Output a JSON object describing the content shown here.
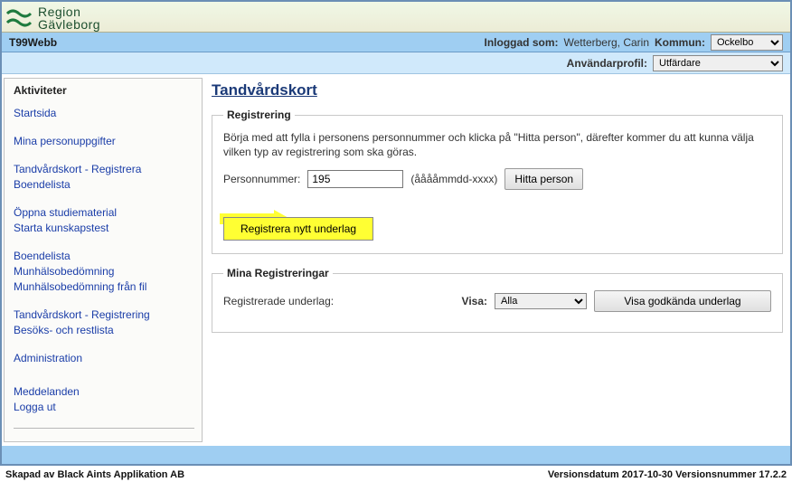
{
  "brand": {
    "line1": "Region",
    "line2": "Gävleborg"
  },
  "topbar": {
    "appname": "T99Webb",
    "logged_in_label": "Inloggad som:",
    "logged_in_user": "Wetterberg, Carin",
    "kommun_label": "Kommun:",
    "kommun_value": "Ockelbo"
  },
  "subbar": {
    "profile_label": "Användarprofil:",
    "profile_value": "Utfärdare"
  },
  "sidebar": {
    "title": "Aktiviteter",
    "links": {
      "start": "Startsida",
      "mina_pu": "Mina personuppgifter",
      "tv_reg": "Tandvårdskort - Registrera",
      "boende": "Boendelista",
      "oppna": "Öppna studiematerial",
      "starta": "Starta kunskapstest",
      "boende2": "Boendelista",
      "munh": "Munhälsobedömning",
      "munh_fil": "Munhälsobedömning från fil",
      "tv_reg2": "Tandvårdskort - Registrering",
      "besok": "Besöks- och restlista",
      "admin": "Administration",
      "medd": "Meddelanden",
      "logga_ut": "Logga ut"
    }
  },
  "main": {
    "title": "Tandvårdskort",
    "reg": {
      "legend": "Registrering",
      "intro": "Börja med att fylla i personens personnummer och klicka på \"Hitta person\", därefter kommer du att kunna välja vilken typ av registrering som ska göras.",
      "pnr_label": "Personnummer:",
      "pnr_value": "195",
      "pnr_hint": "(ååååmmdd-xxxx)",
      "find_btn": "Hitta person",
      "register_btn": "Registrera nytt underlag"
    },
    "mina": {
      "legend": "Mina Registreringar",
      "label": "Registrerade underlag:",
      "visa_label": "Visa:",
      "visa_value": "Alla",
      "btn": "Visa godkända underlag"
    }
  },
  "footer": {
    "left": "Skapad av Black Aints Applikation AB",
    "right": "Versionsdatum 2017-10-30 Versionsnummer 17.2.2"
  }
}
